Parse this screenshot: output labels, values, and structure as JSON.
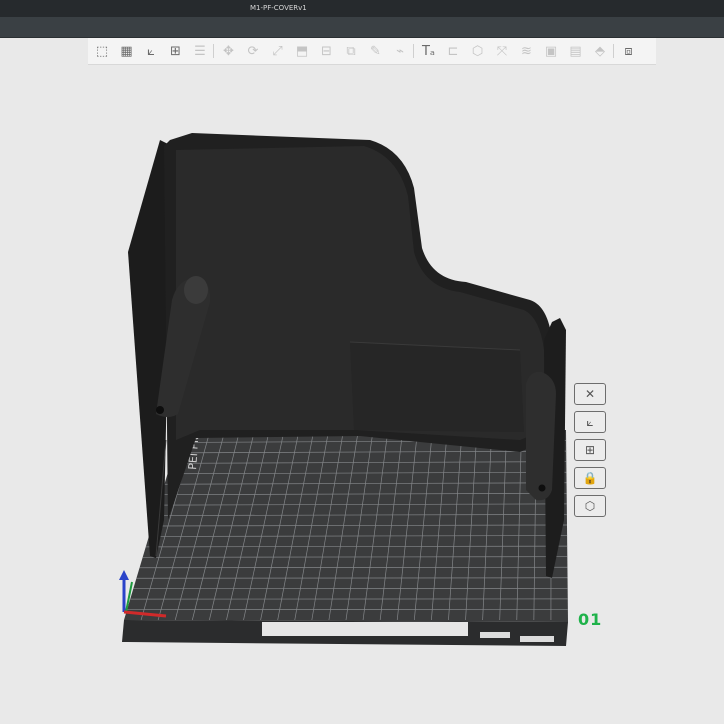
{
  "window": {
    "title": "M1-PF-COVERv1"
  },
  "toolbar": {
    "items": [
      {
        "name": "add-model-icon",
        "glyph": "⬚",
        "enabled": true
      },
      {
        "name": "add-plate-icon",
        "glyph": "▦",
        "enabled": true
      },
      {
        "name": "auto-orient-icon",
        "glyph": "⟀",
        "enabled": true
      },
      {
        "name": "arrange-icon",
        "glyph": "⊞",
        "enabled": true
      },
      {
        "name": "split-objects-icon",
        "glyph": "☰",
        "enabled": false
      },
      {
        "name": "move-icon",
        "glyph": "✥",
        "enabled": false
      },
      {
        "name": "rotate-icon",
        "glyph": "⟳",
        "enabled": false
      },
      {
        "name": "scale-icon",
        "glyph": "⤢",
        "enabled": false
      },
      {
        "name": "lay-on-face-icon",
        "glyph": "⬒",
        "enabled": false
      },
      {
        "name": "cut-icon",
        "glyph": "⊟",
        "enabled": false
      },
      {
        "name": "boolean-icon",
        "glyph": "⧉",
        "enabled": false
      },
      {
        "name": "support-paint-icon",
        "glyph": "✎",
        "enabled": false
      },
      {
        "name": "seam-paint-icon",
        "glyph": "⌁",
        "enabled": false
      },
      {
        "name": "text-icon",
        "glyph": "Tₐ",
        "enabled": true
      },
      {
        "name": "measure-icon",
        "glyph": "⊏",
        "enabled": false
      },
      {
        "name": "assembly-icon",
        "glyph": "⬡",
        "enabled": false
      },
      {
        "name": "explode-icon",
        "glyph": "⤧",
        "enabled": false
      },
      {
        "name": "variable-layer-icon",
        "glyph": "≋",
        "enabled": false
      },
      {
        "name": "color-paint-icon",
        "glyph": "▣",
        "enabled": false
      },
      {
        "name": "fuzzy-skin-icon",
        "glyph": "▤",
        "enabled": false
      },
      {
        "name": "brim-ears-icon",
        "glyph": "⬘",
        "enabled": false
      },
      {
        "name": "view-layout-icon",
        "glyph": "⧈",
        "enabled": true
      }
    ]
  },
  "side_toolbar": {
    "items": [
      {
        "name": "delete-plate-icon",
        "glyph": "✕"
      },
      {
        "name": "orient-plate-icon",
        "glyph": "⟀"
      },
      {
        "name": "arrange-plate-icon",
        "glyph": "⊞"
      },
      {
        "name": "lock-plate-icon",
        "glyph": "🔒"
      },
      {
        "name": "plate-settings-icon",
        "glyph": "⬡"
      }
    ]
  },
  "plate": {
    "number": "01",
    "label": "PEI Plate"
  },
  "colors": {
    "model": "#1e1e1e",
    "plate": "#3b3c3d",
    "grid": "#8c8f92",
    "accent": "#1fb24a",
    "background": "#e9e9e9"
  }
}
